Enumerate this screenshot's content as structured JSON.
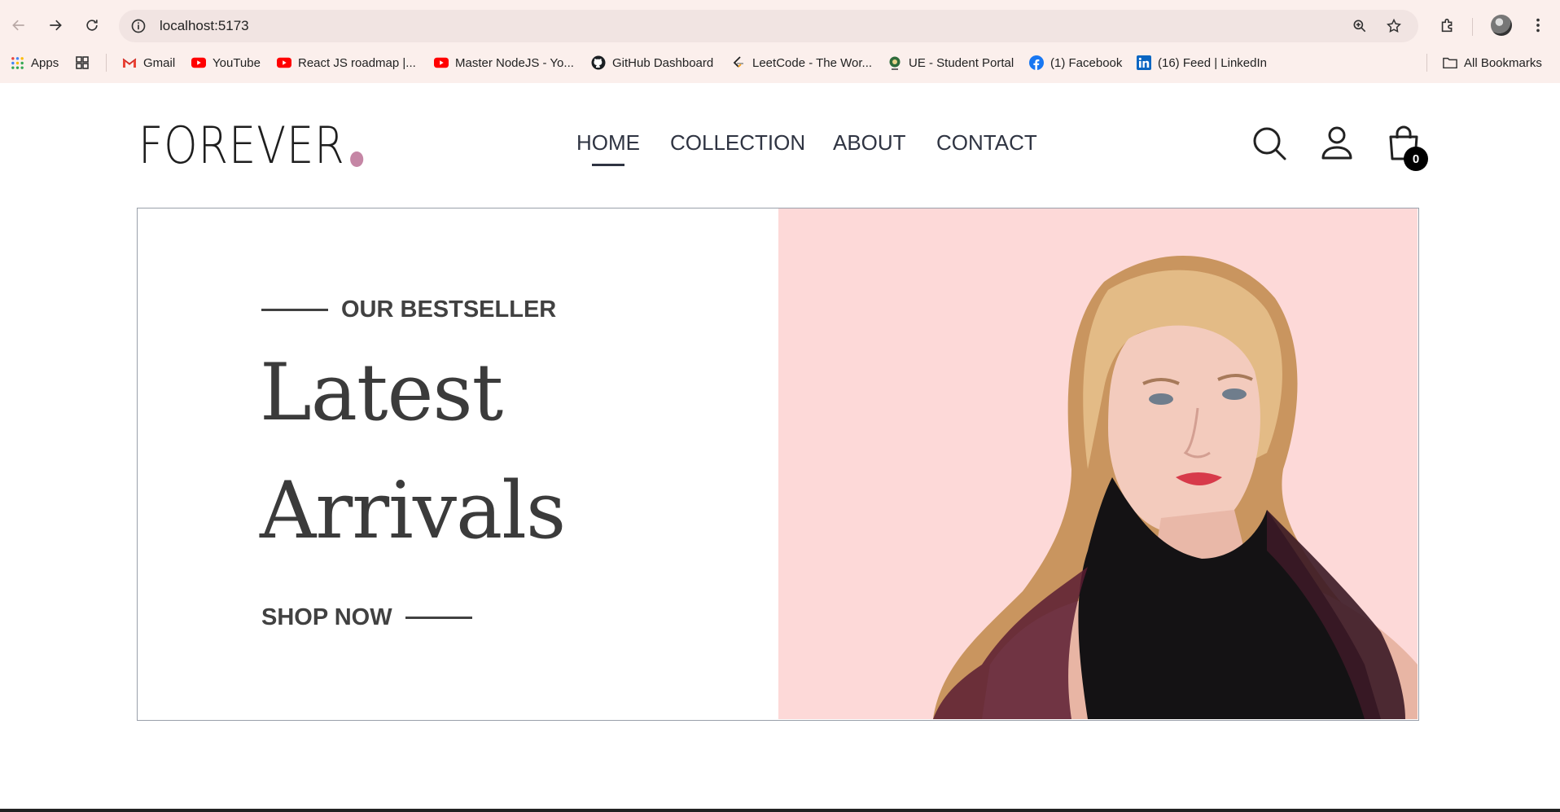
{
  "browser": {
    "url": "localhost:5173",
    "bookmarks": [
      {
        "label": "Apps",
        "icon": "apps-grid-icon"
      },
      {
        "label": "",
        "icon": "tab-groups-icon"
      },
      {
        "label": "Gmail",
        "icon": "gmail-icon"
      },
      {
        "label": "YouTube",
        "icon": "youtube-icon"
      },
      {
        "label": "React JS roadmap |...",
        "icon": "youtube-icon"
      },
      {
        "label": "Master NodeJS - Yo...",
        "icon": "youtube-icon"
      },
      {
        "label": "GitHub Dashboard",
        "icon": "github-icon"
      },
      {
        "label": "LeetCode - The Wor...",
        "icon": "leetcode-icon"
      },
      {
        "label": "UE - Student Portal",
        "icon": "portal-icon"
      },
      {
        "label": "(1) Facebook",
        "icon": "facebook-icon"
      },
      {
        "label": "(16) Feed | LinkedIn",
        "icon": "linkedin-icon"
      }
    ],
    "all_bookmarks": "All Bookmarks"
  },
  "site": {
    "logo": "FOREVER",
    "nav": [
      {
        "label": "HOME",
        "active": true
      },
      {
        "label": "COLLECTION",
        "active": false
      },
      {
        "label": "ABOUT",
        "active": false
      },
      {
        "label": "CONTACT",
        "active": false
      }
    ],
    "cart_count": "0"
  },
  "hero": {
    "kicker": "OUR BESTSELLER",
    "headline_line1": "Latest",
    "headline_line2": "Arrivals",
    "cta": "SHOP NOW",
    "image_bg": "#fdd9d8"
  },
  "colors": {
    "accent_dot": "#c586a5",
    "nav_text": "#2f3442",
    "hero_text": "#414141"
  }
}
